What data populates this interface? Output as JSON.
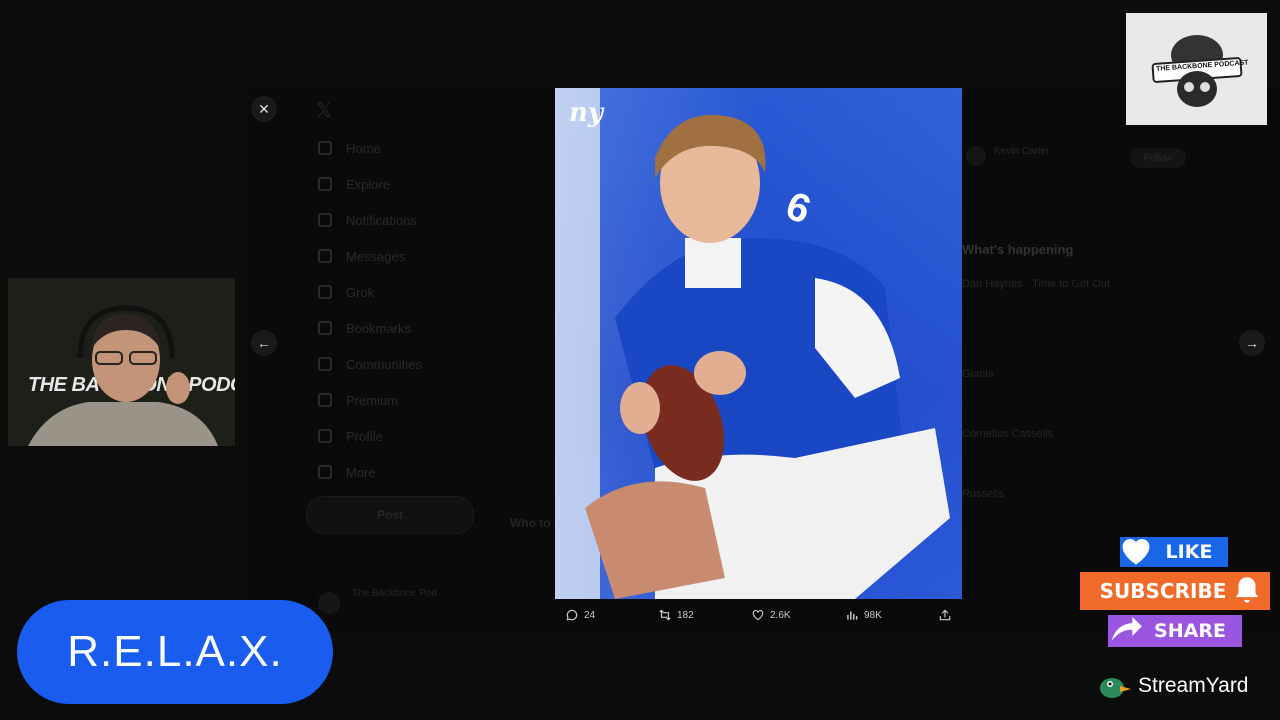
{
  "background_page": {
    "nav": [
      "Home",
      "Explore",
      "Notifications",
      "Messages",
      "Grok",
      "Bookmarks",
      "Communities",
      "Premium",
      "Profile",
      "More"
    ],
    "post_button": "Post",
    "account_name": "The Backbone Pod",
    "sidebar_user": "Kevin Carter",
    "follow_label": "Follow",
    "whats_happening": "What's happening",
    "trending": [
      "Dan Haynes · Time to Get Out",
      "Giants",
      "Cornelius Cassells",
      "Russells"
    ],
    "who_to_follow": "Who to follow"
  },
  "modal": {
    "close_icon": "close-icon",
    "prev_icon": "arrow-left-icon",
    "next_icon": "arrow-right-icon",
    "photo_logo": "ny",
    "jersey_number": "6",
    "actions": {
      "replies": "24",
      "reposts": "182",
      "likes": "2.6K",
      "views": "98K"
    }
  },
  "overlay": {
    "webcam_banner": "THE BACKBONE PODCAST",
    "logo_text": "THE BACKBONE PODCAST",
    "relax_text": "R.E.L.A.X.",
    "like_label": "LIKE",
    "subscribe_label": "SUBSCRIBE",
    "share_label": "SHARE",
    "streamyard_label": "StreamYard"
  },
  "colors": {
    "relax_pill": "#1a5cf0",
    "like": "#1a66e8",
    "subscribe": "#f06a2a",
    "share": "#9a56e0",
    "giants_blue": "#1e48c8"
  }
}
